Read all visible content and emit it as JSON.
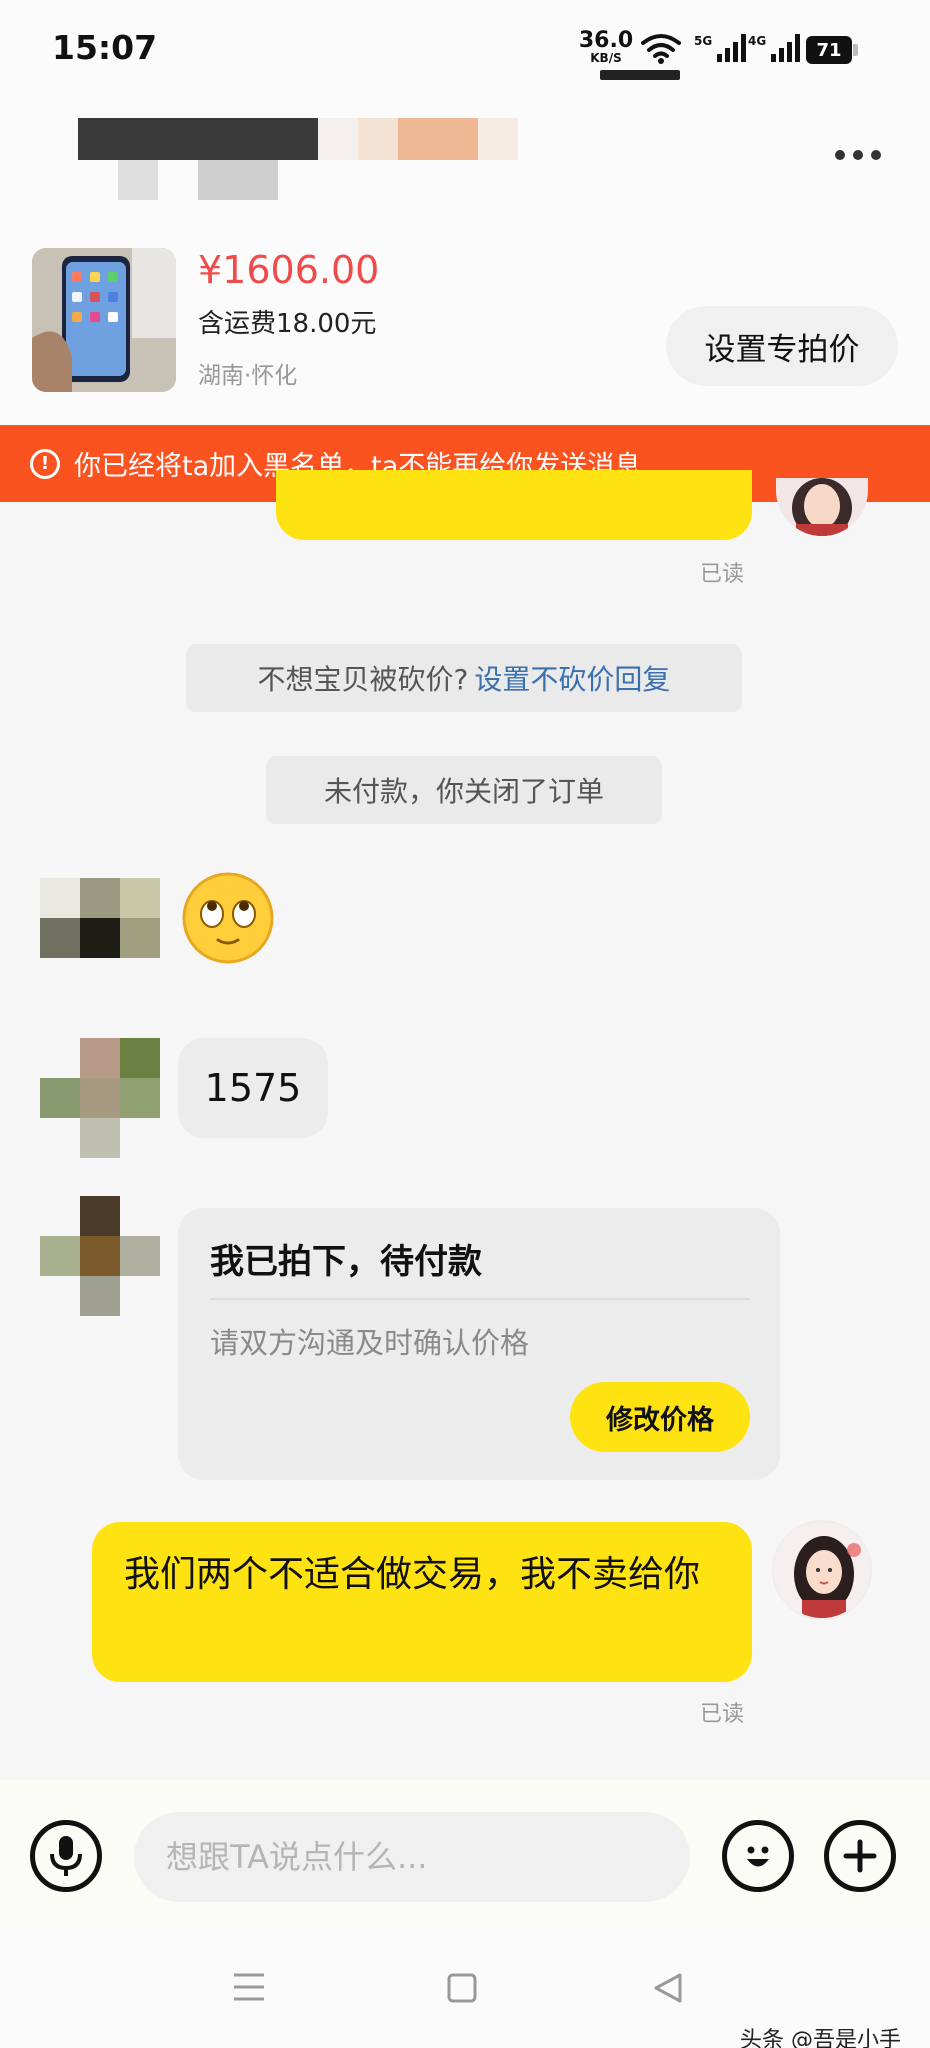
{
  "status_bar": {
    "time": "15:07",
    "net_speed": "36.0",
    "net_unit": "KB/S",
    "sim1_label": "5G",
    "sim2_label": "4G",
    "battery": "71"
  },
  "header": {
    "more_icon": "more-dots-icon"
  },
  "product": {
    "price": "¥1606.00",
    "shipping": "含运费18.00元",
    "location": "湖南·怀化",
    "set_price_button": "设置专拍价"
  },
  "banner": {
    "icon": "warning-circle-icon",
    "text": "你已经将ta加入黑名单，ta不能再给你发送消息"
  },
  "messages": {
    "top_read": "已读",
    "system_notice_prefix": "不想宝贝被砍价?",
    "system_notice_link": "设置不砍价回复",
    "closed_order": "未付款，你关闭了订单",
    "buyer_number": "1575",
    "order_card": {
      "title": "我已拍下，待付款",
      "subtitle": "请双方沟通及时确认价格",
      "button": "修改价格"
    },
    "seller_reply": "我们两个不适合做交易，我不卖给你",
    "bottom_read": "已读"
  },
  "input_bar": {
    "placeholder": "想跟TA说点什么..."
  },
  "watermark": "头条 @吾是小手",
  "colors": {
    "accent_yellow": "#ffe212",
    "banner_orange": "#fa5320",
    "price_red": "#f04b4b",
    "link_blue": "#3a6fb0"
  }
}
